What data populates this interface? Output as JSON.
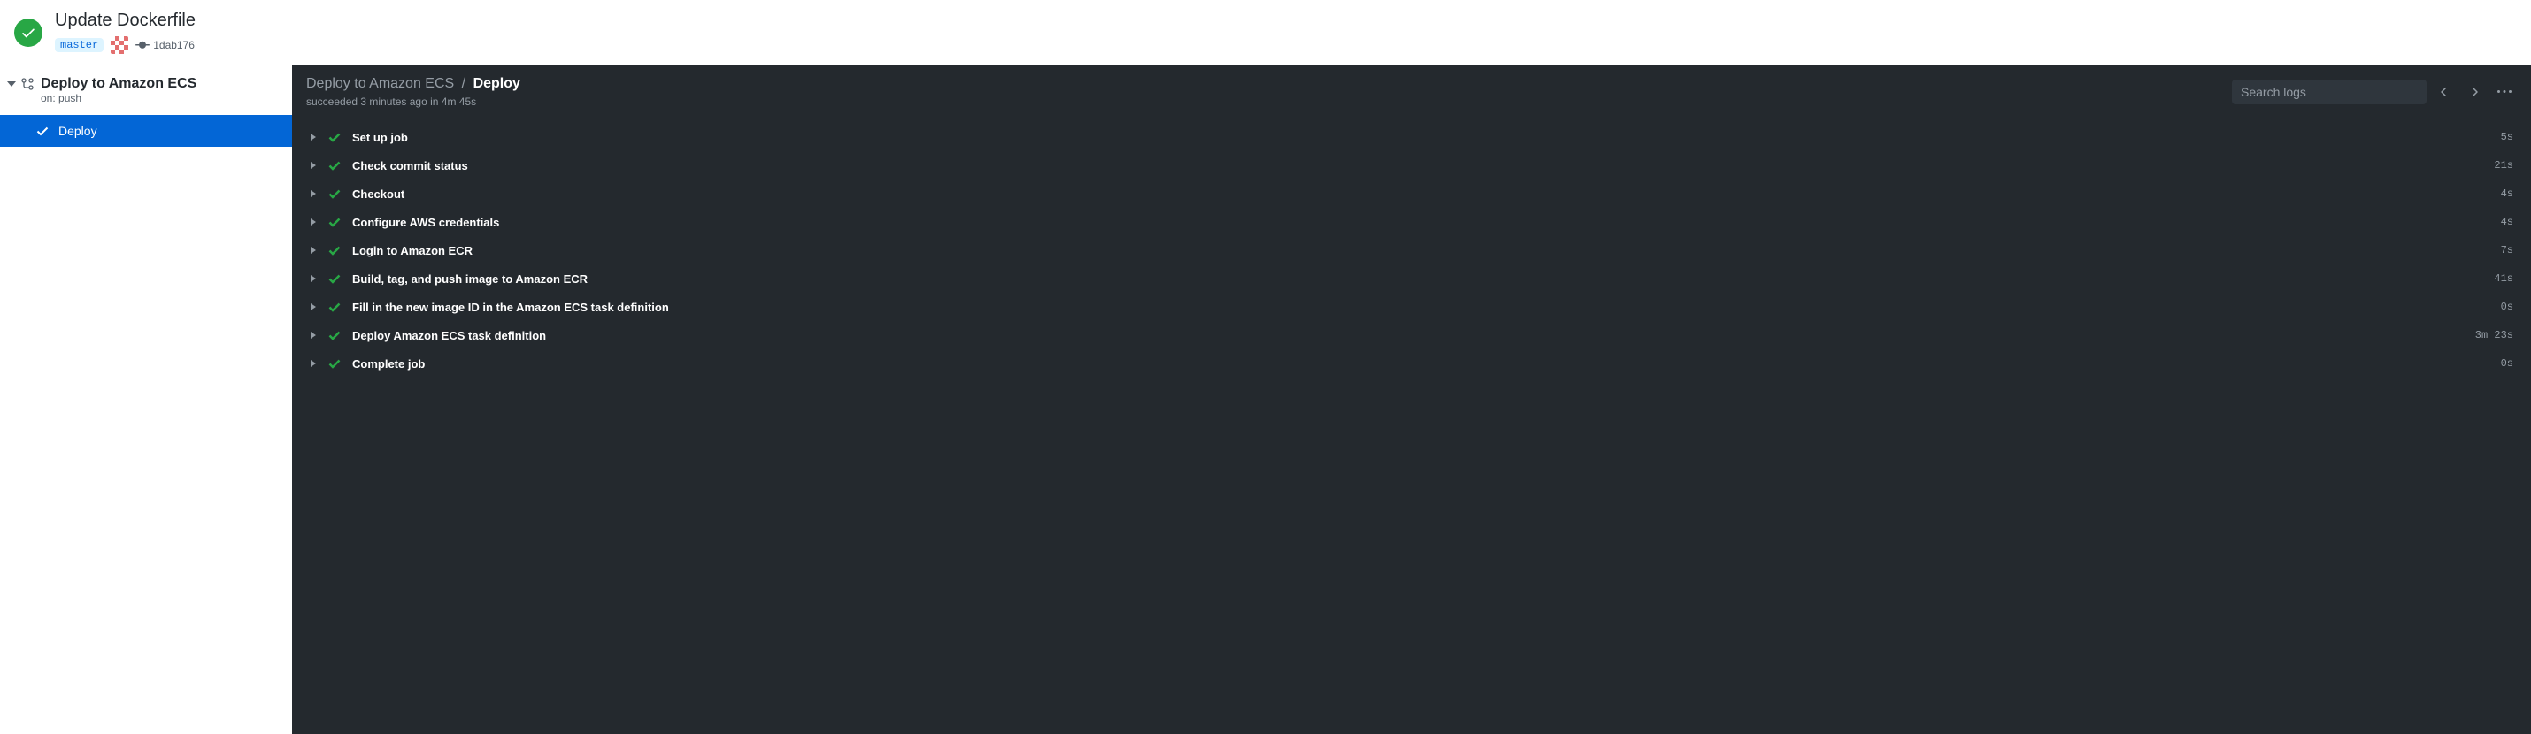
{
  "header": {
    "commit_title": "Update Dockerfile",
    "branch": "master",
    "sha": "1dab176"
  },
  "sidebar": {
    "workflow_name": "Deploy to Amazon ECS",
    "workflow_trigger": "on: push",
    "job_name": "Deploy"
  },
  "main": {
    "breadcrumb_parent": "Deploy to Amazon ECS",
    "breadcrumb_sep": "/",
    "breadcrumb_current": "Deploy",
    "status_line": "succeeded 3 minutes ago in 4m 45s",
    "search_placeholder": "Search logs",
    "steps": [
      {
        "name": "Set up job",
        "time": "5s"
      },
      {
        "name": "Check commit status",
        "time": "21s"
      },
      {
        "name": "Checkout",
        "time": "4s"
      },
      {
        "name": "Configure AWS credentials",
        "time": "4s"
      },
      {
        "name": "Login to Amazon ECR",
        "time": "7s"
      },
      {
        "name": "Build, tag, and push image to Amazon ECR",
        "time": "41s"
      },
      {
        "name": "Fill in the new image ID in the Amazon ECS task definition",
        "time": "0s"
      },
      {
        "name": "Deploy Amazon ECS task definition",
        "time": "3m 23s"
      },
      {
        "name": "Complete job",
        "time": "0s"
      }
    ]
  }
}
